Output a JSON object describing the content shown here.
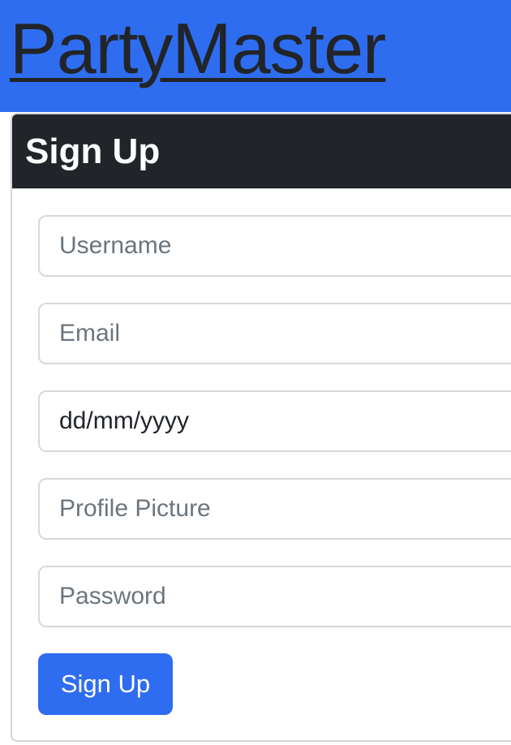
{
  "navbar": {
    "brand": "PartyMaster"
  },
  "form": {
    "title": "Sign Up",
    "fields": {
      "username": {
        "placeholder": "Username",
        "value": ""
      },
      "email": {
        "placeholder": "Email",
        "value": ""
      },
      "birthdate": {
        "placeholder": "dd/mm/yyyy",
        "value": "dd/mm/yyyy"
      },
      "profile_picture": {
        "placeholder": "Profile Picture",
        "value": ""
      },
      "password": {
        "placeholder": "Password",
        "value": ""
      }
    },
    "submit_label": "Sign Up"
  },
  "colors": {
    "primary": "#2f6df0",
    "dark": "#212529",
    "muted_text": "#6c757d",
    "border": "#d6d8db"
  }
}
